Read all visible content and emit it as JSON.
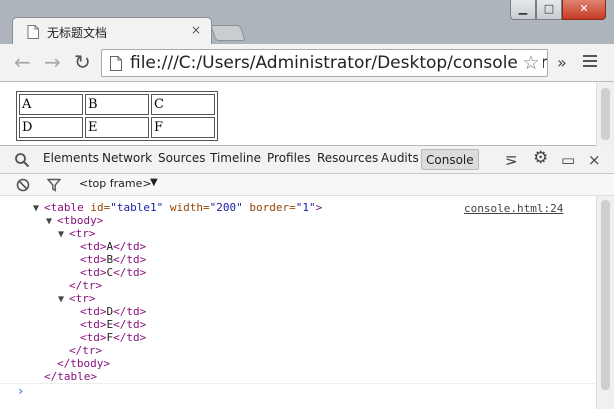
{
  "browser": {
    "tab_title": "无标题文档",
    "tab_close": "×",
    "window": {
      "minimize": "▁",
      "maximize": "□",
      "close": "✕"
    },
    "toolbar": {
      "back": "←",
      "forward": "→",
      "reload": "↻",
      "url": "file:///C:/Users/Administrator/Desktop/console.html",
      "star": "☆",
      "extensions": "»"
    }
  },
  "page": {
    "table_rows": [
      [
        "A",
        "B",
        "C"
      ],
      [
        "D",
        "E",
        "F"
      ]
    ]
  },
  "devtools": {
    "tabs": [
      "Elements",
      "Network",
      "Sources",
      "Timeline",
      "Profiles",
      "Resources",
      "Audits",
      "Console"
    ],
    "active_tab": "Console",
    "toolbar_icons": {
      "drawer": "⋝",
      "settings": "⚙",
      "dock": "▭",
      "close": "×"
    },
    "frame_selector": "<top frame>",
    "frame_arrow": "▼",
    "source_link": "console.html:24",
    "prompt": "›",
    "log": {
      "table_open": {
        "tag": "<table",
        "id_attr": " id=",
        "id_val": "\"table1\"",
        "width_attr": " width=",
        "width_val": "\"200\"",
        "border_attr": " border=",
        "border_val": "\"1\"",
        "end": ">"
      },
      "tbody_open": "<tbody>",
      "tr_open": "<tr>",
      "td_open": "<td>",
      "td_close": "</td>",
      "tr_close": "</tr>",
      "tbody_close": "</tbody>",
      "table_close": "</table>",
      "expanded": "▼"
    }
  },
  "colors": {
    "titlebar": "#aeb4bb",
    "tag": "#881280",
    "attr_name": "#994500",
    "attr_value": "#1a1aa6",
    "prompt": "#367cf1"
  }
}
